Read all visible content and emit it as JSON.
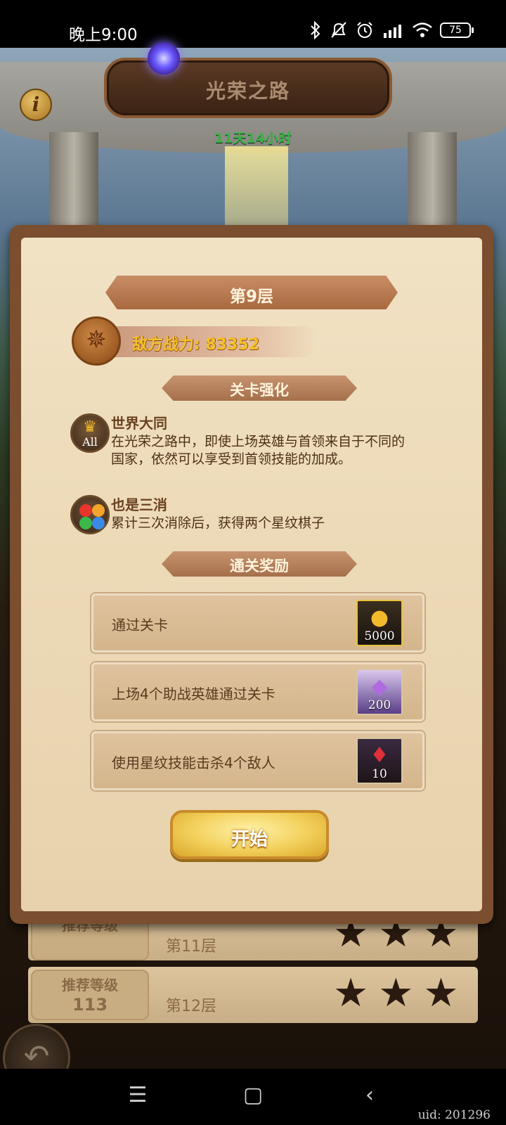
{
  "status_bar": {
    "time": "晚上9:00",
    "battery": "75"
  },
  "header": {
    "title": "光荣之路",
    "timer": "11天14小时",
    "info_glyph": "i"
  },
  "floor_list": [
    {
      "recommend_label": "推荐等级",
      "recommend_level": "",
      "floor": "第11层"
    },
    {
      "recommend_label": "推荐等级",
      "recommend_level": "113",
      "floor": "第12层"
    }
  ],
  "dialog": {
    "floor_title": "第9层",
    "enemy_power": "敌方战力: 83352",
    "modifiers_title": "关卡强化",
    "modifiers": [
      {
        "icon": "crown-all-icon",
        "icon_text": "All",
        "title": "世界大同",
        "desc": "在光荣之路中，即使上场英雄与首领来自于不同的国家，依然可以享受到首领技能的加成。"
      },
      {
        "icon": "gems-icon",
        "title": "也是三消",
        "desc": "累计三次消除后，获得两个星纹棋子"
      }
    ],
    "rewards_title": "通关奖励",
    "rewards": [
      {
        "label": "通过关卡",
        "item": "gold-coin-icon",
        "qty": "5000"
      },
      {
        "label": "上场4个助战英雄通过关卡",
        "item": "purple-crystal-icon",
        "qty": "200"
      },
      {
        "label": "使用星纹技能击杀4个敌人",
        "item": "red-gem-icon",
        "qty": "10"
      }
    ],
    "start_button": "开始"
  },
  "footer": {
    "uid": "uid: 201296"
  },
  "colors": {
    "parchment": "#ecd9b6",
    "power_text": "#f6c22a",
    "timer": "#3cb24a"
  }
}
